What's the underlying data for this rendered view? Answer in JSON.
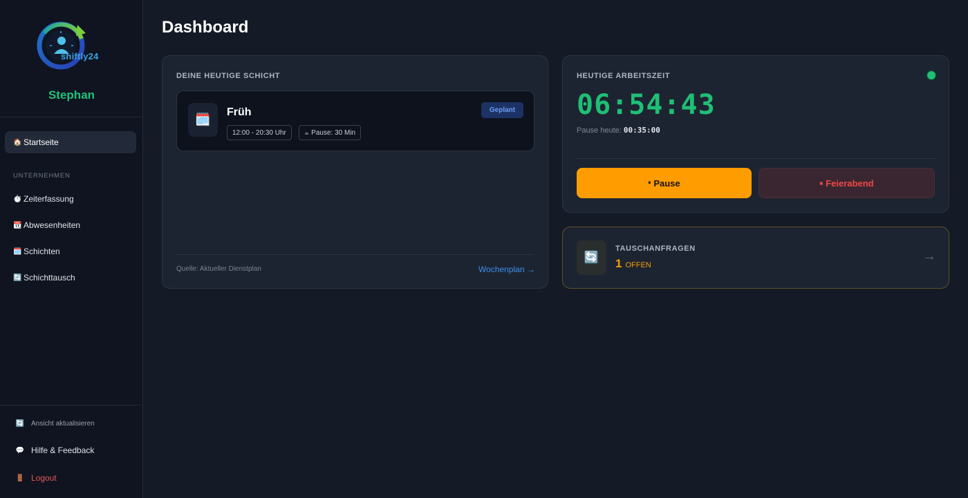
{
  "brand": {
    "name": "shiftly24"
  },
  "user": {
    "name": "Stephan"
  },
  "sidebar": {
    "home": {
      "icon": "🏠",
      "label": "Startseite"
    },
    "section_label": "UNTERNEHMEN",
    "items": [
      {
        "icon": "⏱️",
        "label": "Zeiterfassung"
      },
      {
        "icon": "📆",
        "label": "Abwesenheiten"
      },
      {
        "icon": "🗓️",
        "label": "Schichten"
      },
      {
        "icon": "🔄",
        "label": "Schichttausch"
      }
    ],
    "footer": {
      "refresh": {
        "icon": "🔄",
        "label": "Ansicht aktualisieren"
      },
      "help": {
        "icon": "💬",
        "label": "Hilfe & Feedback"
      },
      "logout": {
        "icon": "🚪",
        "label": "Logout"
      }
    }
  },
  "page": {
    "title": "Dashboard"
  },
  "shift_card": {
    "title": "DEINE HEUTIGE SCHICHT",
    "icon": "🗓️",
    "shift_name": "Früh",
    "time_range": "12:00 - 20:30 Uhr",
    "pause_icon": "☕",
    "pause": "Pause: 30 Min",
    "status": "Geplant",
    "source": "Quelle: Aktueller Dienstplan",
    "week_link": "Wochenplan →"
  },
  "worktime_card": {
    "title": "HEUTIGE ARBEITSZEIT",
    "timer": "06:54:43",
    "pause_label": "Pause heute:",
    "pause_value": "00:35:00",
    "pause_button": {
      "icon": "⏸",
      "label": "Pause"
    },
    "end_button": {
      "icon": "■",
      "label": "Feierabend"
    }
  },
  "swap_card": {
    "icon": "🔄",
    "title": "TAUSCHANFRAGEN",
    "count": "1",
    "count_label": "OFFEN",
    "arrow": "→"
  },
  "colors": {
    "accent_green": "#1fbf74",
    "accent_orange": "#ff9d00",
    "danger": "#f04848",
    "link_blue": "#3d8ff0"
  }
}
